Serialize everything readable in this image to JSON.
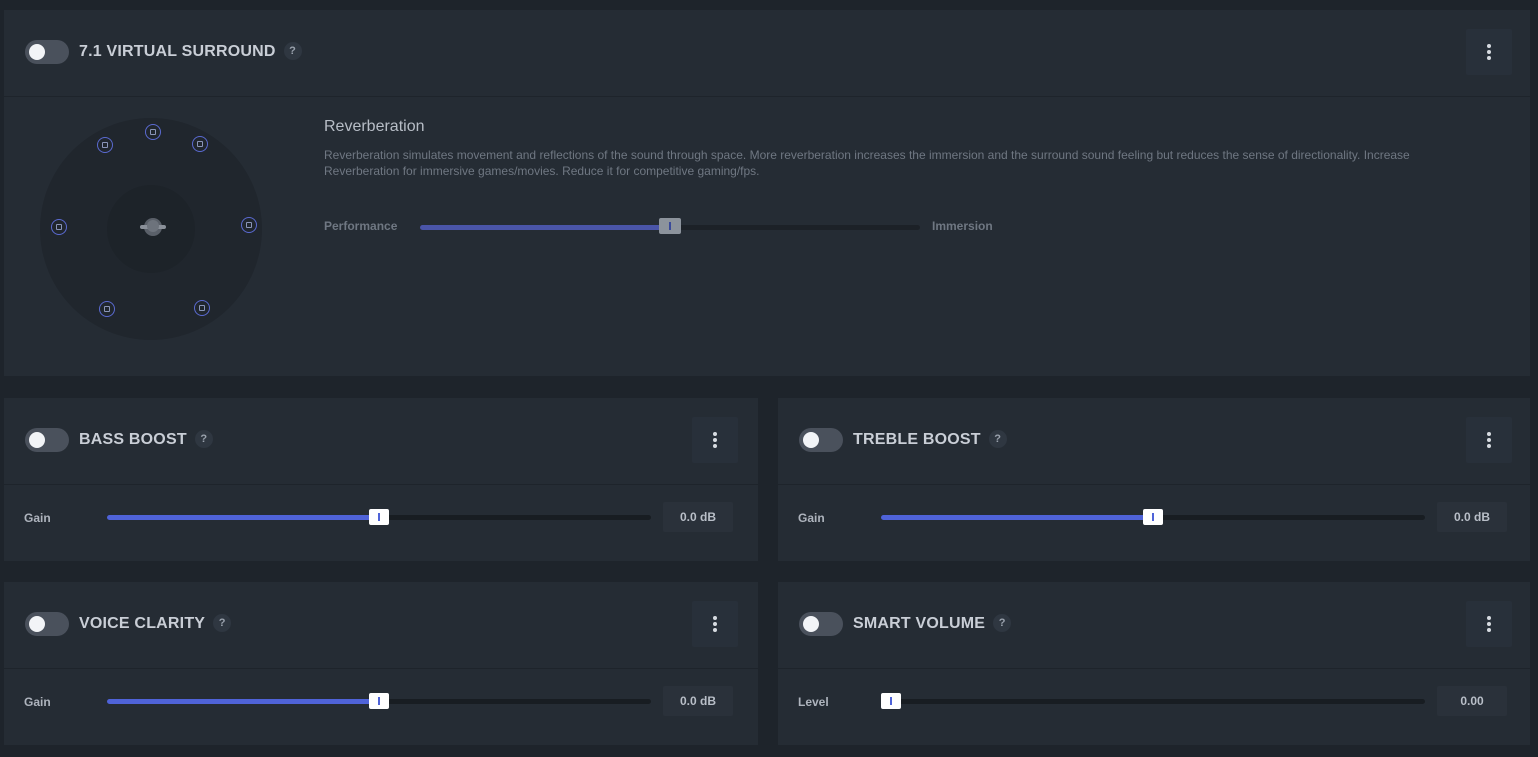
{
  "virtual_surround": {
    "title": "7.1 VIRTUAL SURROUND",
    "help": "?",
    "enabled": false,
    "reverb": {
      "title": "Reverberation",
      "description": "Reverberation simulates movement and reflections of the sound through space. More reverberation increases the immersion and the surround sound feeling but reduces the sense of directionality. Increase Reverberation for immersive games/movies. Reduce it for competitive gaming/fps.",
      "left_label": "Performance",
      "right_label": "Immersion",
      "level_fraction": 0.5
    }
  },
  "bass_boost": {
    "title": "BASS BOOST",
    "help": "?",
    "enabled": false,
    "control_label": "Gain",
    "value": "0.0 dB",
    "level_fraction": 0.5
  },
  "treble_boost": {
    "title": "TREBLE BOOST",
    "help": "?",
    "enabled": false,
    "control_label": "Gain",
    "value": "0.0 dB",
    "level_fraction": 0.5
  },
  "voice_clarity": {
    "title": "VOICE CLARITY",
    "help": "?",
    "enabled": false,
    "control_label": "Gain",
    "value": "0.0 dB",
    "level_fraction": 0.5
  },
  "smart_volume": {
    "title": "SMART VOLUME",
    "help": "?",
    "enabled": false,
    "control_label": "Level",
    "value": "0.00",
    "level_fraction": 0.0
  },
  "colors": {
    "accent": "#4f63d8",
    "card_bg": "#252c34",
    "page_bg": "#1e242b"
  }
}
